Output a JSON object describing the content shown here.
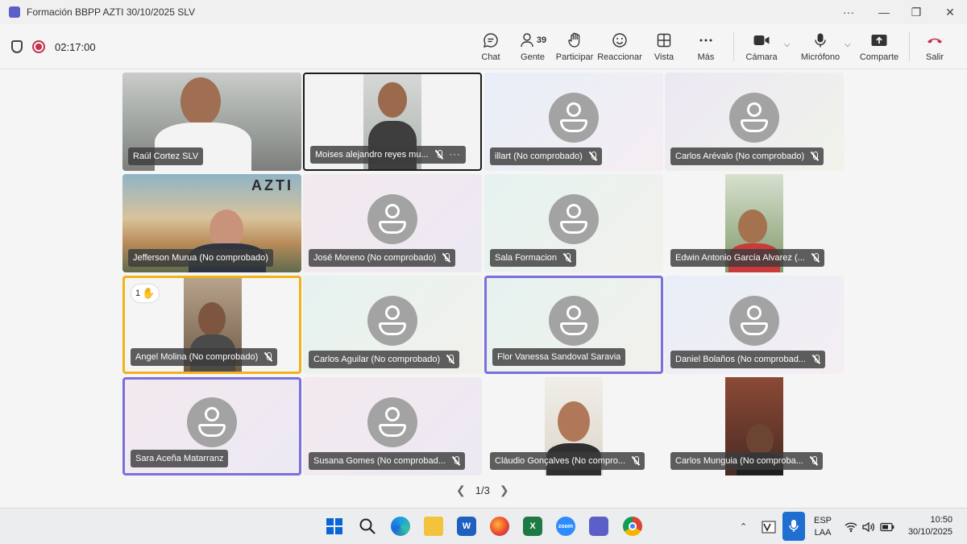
{
  "window": {
    "title": "Formación BBPP AZTI 30/10/2025 SLV",
    "controls": [
      "···",
      "—",
      "❐",
      "✕"
    ]
  },
  "meeting": {
    "timer": "02:17:00",
    "toolbar": {
      "chat": "Chat",
      "people": "Gente",
      "people_count": "39",
      "raise": "Participar",
      "react": "Reaccionar",
      "view": "Vista",
      "more": "Más",
      "camera": "Cámara",
      "mic": "Micrófono",
      "share": "Comparte",
      "leave": "Salir"
    }
  },
  "participants": [
    {
      "name": "Raúl Cortez SLV",
      "muted": false,
      "video": true
    },
    {
      "name": "Moises alejandro reyes mu...",
      "muted": true,
      "video": true,
      "more": "···"
    },
    {
      "name": "illart (No comprobado)",
      "muted": true,
      "video": false
    },
    {
      "name": "Carlos Arévalo (No comprobado)",
      "muted": true,
      "video": false
    },
    {
      "name": "Jefferson Murua (No comprobado)",
      "muted": false,
      "video": true,
      "logo": "AZTI"
    },
    {
      "name": "José Moreno (No comprobado)",
      "muted": true,
      "video": false
    },
    {
      "name": "Sala Formacion",
      "muted": true,
      "video": false
    },
    {
      "name": "Edwin Antonio García Alvarez (...",
      "muted": true,
      "video": true
    },
    {
      "name": "Angel Molina (No comprobado)",
      "muted": true,
      "video": true,
      "hand_count": "1"
    },
    {
      "name": "Carlos Aguilar (No comprobado)",
      "muted": true,
      "video": false
    },
    {
      "name": "Flor Vanessa Sandoval Saravia",
      "muted": false,
      "video": false
    },
    {
      "name": "Daniel Bolaños (No comprobad...",
      "muted": true,
      "video": false
    },
    {
      "name": "Sara Aceña Matarranz",
      "muted": false,
      "video": false
    },
    {
      "name": "Susana Gomes (No comprobad...",
      "muted": true,
      "video": false
    },
    {
      "name": "Cláudio Gonçalves (No compro...",
      "muted": true,
      "video": true
    },
    {
      "name": "Carlos Munguia (No comproba...",
      "muted": true,
      "video": true
    }
  ],
  "pager": {
    "label": "1/3"
  },
  "taskbar": {
    "apps": [
      "windows-start",
      "search",
      "edge",
      "file-explorer",
      "word",
      "firefox",
      "excel",
      "zoom",
      "teams",
      "chrome"
    ],
    "zoom_label": "zoom",
    "word_label": "W",
    "excel_label": "X",
    "lang_1": "ESP",
    "lang_2": "LAA",
    "time": "10:50",
    "date": "30/10/2025"
  },
  "colors": {
    "accent": "#7b6fdc",
    "speaking_border": "#1b1b1b",
    "hand_border": "#f2b21a",
    "record": "#c4314b"
  }
}
